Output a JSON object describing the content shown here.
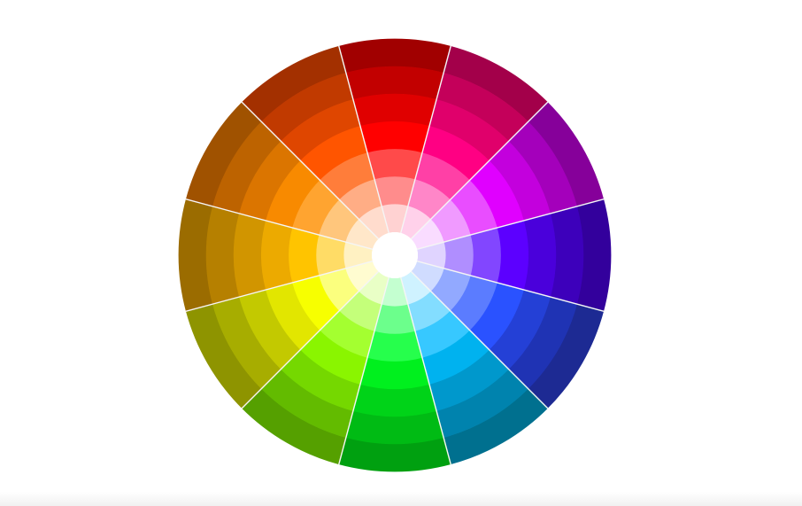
{
  "color_wheel": {
    "segments": [
      {
        "hue": "red",
        "rings": [
          "#a10000",
          "#c20000",
          "#e00000",
          "#ff0000",
          "#ff4a4a",
          "#ff8c8c",
          "#ffd2d2"
        ]
      },
      {
        "hue": "magenta",
        "rings": [
          "#a3004a",
          "#c4005a",
          "#e0006b",
          "#ff0083",
          "#ff40a6",
          "#ff86c8",
          "#ffd1ea"
        ]
      },
      {
        "hue": "violet",
        "rings": [
          "#86009a",
          "#a400bb",
          "#c300dd",
          "#e000ff",
          "#e94dff",
          "#f09aff",
          "#f9dcff"
        ]
      },
      {
        "hue": "blue-violet",
        "rings": [
          "#33009c",
          "#3d00bb",
          "#4a00db",
          "#5c00ff",
          "#8246ff",
          "#b08eff",
          "#e0d4ff"
        ]
      },
      {
        "hue": "blue",
        "rings": [
          "#1d2a93",
          "#1f33b4",
          "#2440d6",
          "#2a52ff",
          "#5b7cff",
          "#92a9ff",
          "#d0dcff"
        ]
      },
      {
        "hue": "cyan-blue",
        "rings": [
          "#00708f",
          "#0083ae",
          "#0098cc",
          "#00b2ef",
          "#37c8ff",
          "#83ddff",
          "#cff2ff"
        ]
      },
      {
        "hue": "green",
        "rings": [
          "#00a010",
          "#00bb14",
          "#00d318",
          "#00f01e",
          "#26ff4c",
          "#6cff8c",
          "#c4ffd0"
        ]
      },
      {
        "hue": "yellow-green",
        "rings": [
          "#55a000",
          "#63bb00",
          "#75d800",
          "#8af500",
          "#a4ff30",
          "#c4ff7a",
          "#e9ffc6"
        ]
      },
      {
        "hue": "yellow-olive",
        "rings": [
          "#8e9400",
          "#a7ad00",
          "#c3c900",
          "#e2e600",
          "#f7ff00",
          "#fbff7e",
          "#fffcd0"
        ]
      },
      {
        "hue": "amber",
        "rings": [
          "#9b6c00",
          "#b68000",
          "#d19500",
          "#ecaa00",
          "#ffc400",
          "#ffdc66",
          "#fff1c2"
        ]
      },
      {
        "hue": "orange",
        "rings": [
          "#a05200",
          "#bd6300",
          "#db7500",
          "#f88a00",
          "#ffa430",
          "#ffc67c",
          "#ffe7c9"
        ]
      },
      {
        "hue": "red-orange",
        "rings": [
          "#a33000",
          "#c13a00",
          "#df4600",
          "#ff5500",
          "#ff7d3a",
          "#ffad85",
          "#ffdccd"
        ]
      }
    ],
    "separator_color": "#f5f5f5",
    "center_color": "#ffffff",
    "background_color": "#ffffff"
  }
}
